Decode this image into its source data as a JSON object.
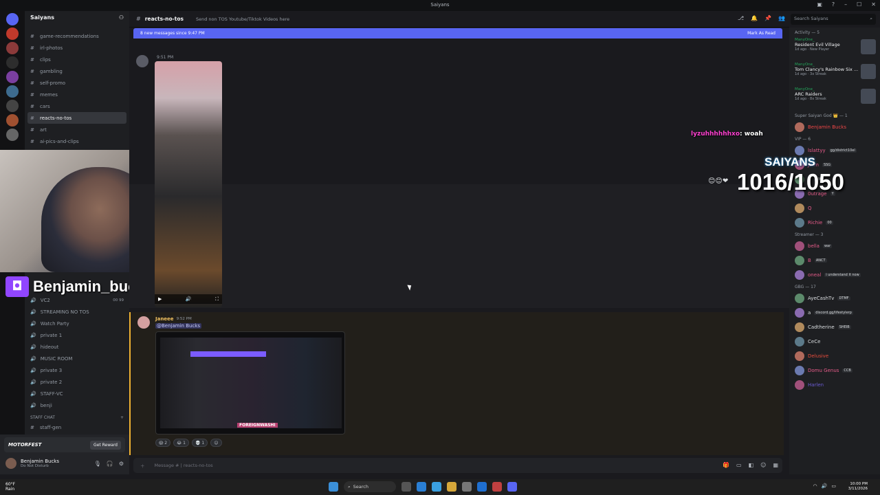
{
  "window": {
    "title": "Saiyans"
  },
  "server": {
    "name": "Saiyans"
  },
  "channels": [
    {
      "name": "game-recommendations"
    },
    {
      "name": "irl-photos"
    },
    {
      "name": "clips"
    },
    {
      "name": "gambling"
    },
    {
      "name": "self-promo"
    },
    {
      "name": "memes"
    },
    {
      "name": "cars"
    },
    {
      "name": "reacts-no-tos"
    },
    {
      "name": "art"
    },
    {
      "name": "ai-pics-and-clips"
    }
  ],
  "voice_channels": [
    {
      "name": "VC2",
      "count": "00 99"
    },
    {
      "name": "STREAMING NO TOS"
    },
    {
      "name": "Watch Party"
    },
    {
      "name": "private 1"
    },
    {
      "name": "hideout"
    },
    {
      "name": "MUSIC ROOM"
    },
    {
      "name": "private 3"
    },
    {
      "name": "private 2"
    },
    {
      "name": "STAFF-VC"
    },
    {
      "name": "benji"
    }
  ],
  "staff_category": "STAFF CHAT",
  "staff_channel": "staff-gen",
  "stream_overlay": {
    "streamer": "Benjamin_bucks",
    "chat_nick": "lyzuhhhhhhxo",
    "chat_text": "woah",
    "sub_title": "SAIYANS",
    "sub_count": "1016/1050"
  },
  "promo": {
    "brand": "MOTORFEST",
    "cta": "Get Reward"
  },
  "user": {
    "name": "Benjamin Bucks",
    "status": "Do Not Disturb"
  },
  "header": {
    "channel": "reacts-no-tos",
    "topic": "Send non TOS Youtube/Tiktok Videos here",
    "search_placeholder": "Search Saiyans"
  },
  "new_messages": {
    "text": "8 new messages since 9:47 PM",
    "action": "Mark As Read"
  },
  "messages": [
    {
      "time": "9:51 PM"
    },
    {
      "author": "Janeee",
      "time": "9:52 PM",
      "mention": "@Benjamin Bucks",
      "image_caption": "FOREIGNWASHI"
    }
  ],
  "reactions": [
    {
      "emoji": "😱",
      "count": "2"
    },
    {
      "emoji": "😂",
      "count": "1"
    },
    {
      "emoji": "💀",
      "count": "1"
    },
    {
      "emoji": "☺",
      "count": ""
    }
  ],
  "composer": {
    "placeholder": "Message # | reacts-no-tos"
  },
  "members_panel": {
    "activity_header": "Activity — 5",
    "activities": [
      {
        "user": "ManyOne_",
        "game": "Resident Evil Village",
        "meta": "1d ago · New Player"
      },
      {
        "user": "ManyOne_",
        "game": "Tom Clancy's Rainbow Six ...",
        "meta": "1d ago · 3x Streak"
      },
      {
        "user": "ManyOne_",
        "game": "ARC Raiders",
        "meta": "1d ago · 8x Streak"
      }
    ],
    "groups": [
      {
        "header": "Super Saiyan God 👑 — 1",
        "members": [
          {
            "name": "Benjamin Bucks",
            "color": "#f04747"
          }
        ]
      },
      {
        "header": "VIP — 6",
        "members": [
          {
            "name": "lslattyy",
            "color": "#e75c8a",
            "tag": "gg/district10el"
          },
          {
            "name": "Jerm",
            "color": "#e75c8a",
            "tag": "SSG"
          },
          {
            "name": "L",
            "color": "#e75c8a",
            "tag": "666"
          },
          {
            "name": "0utrage",
            "color": "#e75c8a",
            "tag": "Y"
          },
          {
            "name": "Q",
            "color": "#e75c8a"
          },
          {
            "name": "Richie",
            "color": "#e75c8a",
            "tag": "00"
          }
        ]
      },
      {
        "header": "Streamer — 3",
        "members": [
          {
            "name": "bella",
            "color": "#e75c8a",
            "tag": "war"
          },
          {
            "name": "B",
            "color": "#e75c8a",
            "tag": "ANCT"
          },
          {
            "name": "oneal",
            "color": "#e75c8a",
            "tag": "i understand it now"
          }
        ]
      },
      {
        "header": "GBG — 17",
        "members": [
          {
            "name": "AyeCashTv",
            "color": "#dbdee1",
            "tag": "DTMF"
          },
          {
            "name": "a",
            "color": "#dbdee1",
            "tag": "discord.gg/lifestylerp"
          },
          {
            "name": "Cadtherine",
            "color": "#dbdee1",
            "tag": "SHEIB"
          },
          {
            "name": "CeCe",
            "color": "#dbdee1"
          },
          {
            "name": "Delusive",
            "color": "#e74c3c"
          },
          {
            "name": "Domu Genus",
            "color": "#e75c8a",
            "tag": "CCB"
          },
          {
            "name": "Harlen",
            "color": "#6b5bd2"
          }
        ]
      }
    ]
  },
  "taskbar": {
    "weather": "60°F",
    "weather_sub": "Rain",
    "search": "Search",
    "time": "10:00 PM",
    "date": "3/11/2026"
  }
}
